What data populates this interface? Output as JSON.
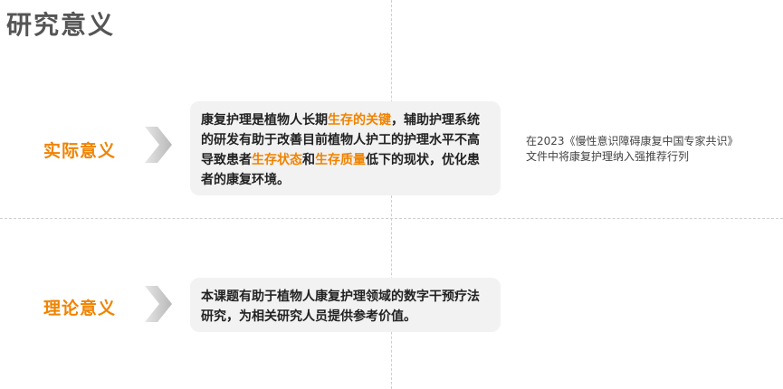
{
  "title": "研究意义",
  "practical": {
    "label": "实际意义",
    "text": {
      "p1": "康复护理是植物人长期",
      "h1": "生存的关键",
      "p2": "，辅助护理系统的研发有助于改善目前植物人护工的护理水平不高导致患者",
      "h2": "生存状态",
      "p3": "和",
      "h3": "生存质量",
      "p4": "低下的现状，优化患者的康复环境。"
    },
    "note_line1": "在2023《慢性意识障碍康复中国专家共识》",
    "note_line2": "文件中将康复护理纳入强推荐行列"
  },
  "theoretical": {
    "label": "理论意义",
    "text": "本课题有助于植物人康复护理领域的数字干预疗法研究，为相关研究人员提供参考价值。"
  },
  "colors": {
    "accent": "#f08300",
    "card_bg": "#f2f2f2",
    "title": "#555555",
    "arrow": "#c8c8c8"
  },
  "icons": {
    "section_arrow": "chevron-right-icon"
  }
}
